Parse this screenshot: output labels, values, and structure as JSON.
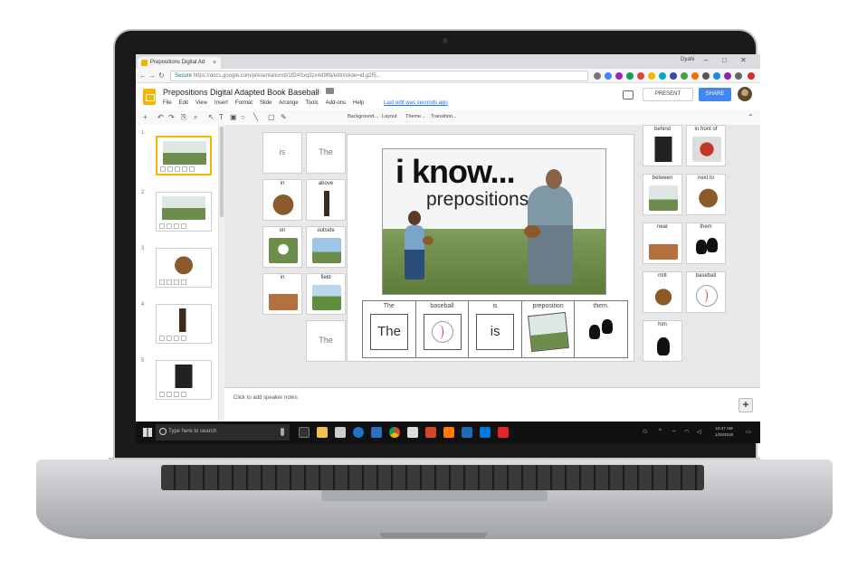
{
  "browser": {
    "tab_title": "Prepositions Digital Ad",
    "tab_close": "×",
    "profile": "Dyahi",
    "url_secure": "Secure",
    "url": "https://docs.google.com/presentation/d/1fD4Sxq3zx4d9f8j/edit#slide=id.g2f5..."
  },
  "slides": {
    "title": "Prepositions Digital Adapted Book Baseball",
    "menu": [
      "File",
      "Edit",
      "View",
      "Insert",
      "Format",
      "Slide",
      "Arrange",
      "Tools",
      "Add-ons",
      "Help"
    ],
    "last_edit": "Last edit was seconds ago",
    "present_label": "PRESENT",
    "share_label": "SHARE",
    "toolbar_labels": [
      "Background...",
      "Layout",
      "Theme...",
      "Transition..."
    ],
    "speaker_notes": "Click to add speaker notes"
  },
  "filmstrip": {
    "numbers": [
      "1",
      "2",
      "3",
      "4",
      "5"
    ]
  },
  "left_cards": [
    {
      "label": "is",
      "style": "big"
    },
    {
      "label": "The",
      "style": "big"
    },
    {
      "label": "in",
      "style": "glove"
    },
    {
      "label": "above",
      "style": "hand"
    },
    {
      "label": "on",
      "style": "ball-grass"
    },
    {
      "label": "outside",
      "style": "sky"
    },
    {
      "label": "in",
      "style": "dirt"
    },
    {
      "label": "field",
      "style": "field"
    },
    {
      "label": "The",
      "style": "big"
    }
  ],
  "right_cards": [
    {
      "label": "behind",
      "style": "dark"
    },
    {
      "label": "in front of",
      "style": "catcher"
    },
    {
      "label": "between",
      "style": "field"
    },
    {
      "label": "next to",
      "style": "glove"
    },
    {
      "label": "near",
      "style": "dirt"
    },
    {
      "label": "them",
      "style": "silhouettes"
    },
    {
      "label": "mitt",
      "style": "mitt"
    },
    {
      "label": "baseball",
      "style": "ball"
    },
    {
      "label": "him",
      "style": "silhouette"
    }
  ],
  "slide": {
    "headline": "i know...",
    "subtitle": "prepositions",
    "sentence": [
      {
        "top": "The",
        "box": "The"
      },
      {
        "top": "baseball",
        "box": ""
      },
      {
        "top": "is",
        "box": "is"
      },
      {
        "top": "preposition",
        "box": ""
      },
      {
        "top": "them.",
        "box": ""
      }
    ]
  },
  "taskbar": {
    "search_placeholder": "Type here to search",
    "time": "10:47 AM",
    "date": "1/26/2018"
  },
  "colors": {
    "share_blue": "#4285f4",
    "slides_yellow": "#f4b400"
  }
}
